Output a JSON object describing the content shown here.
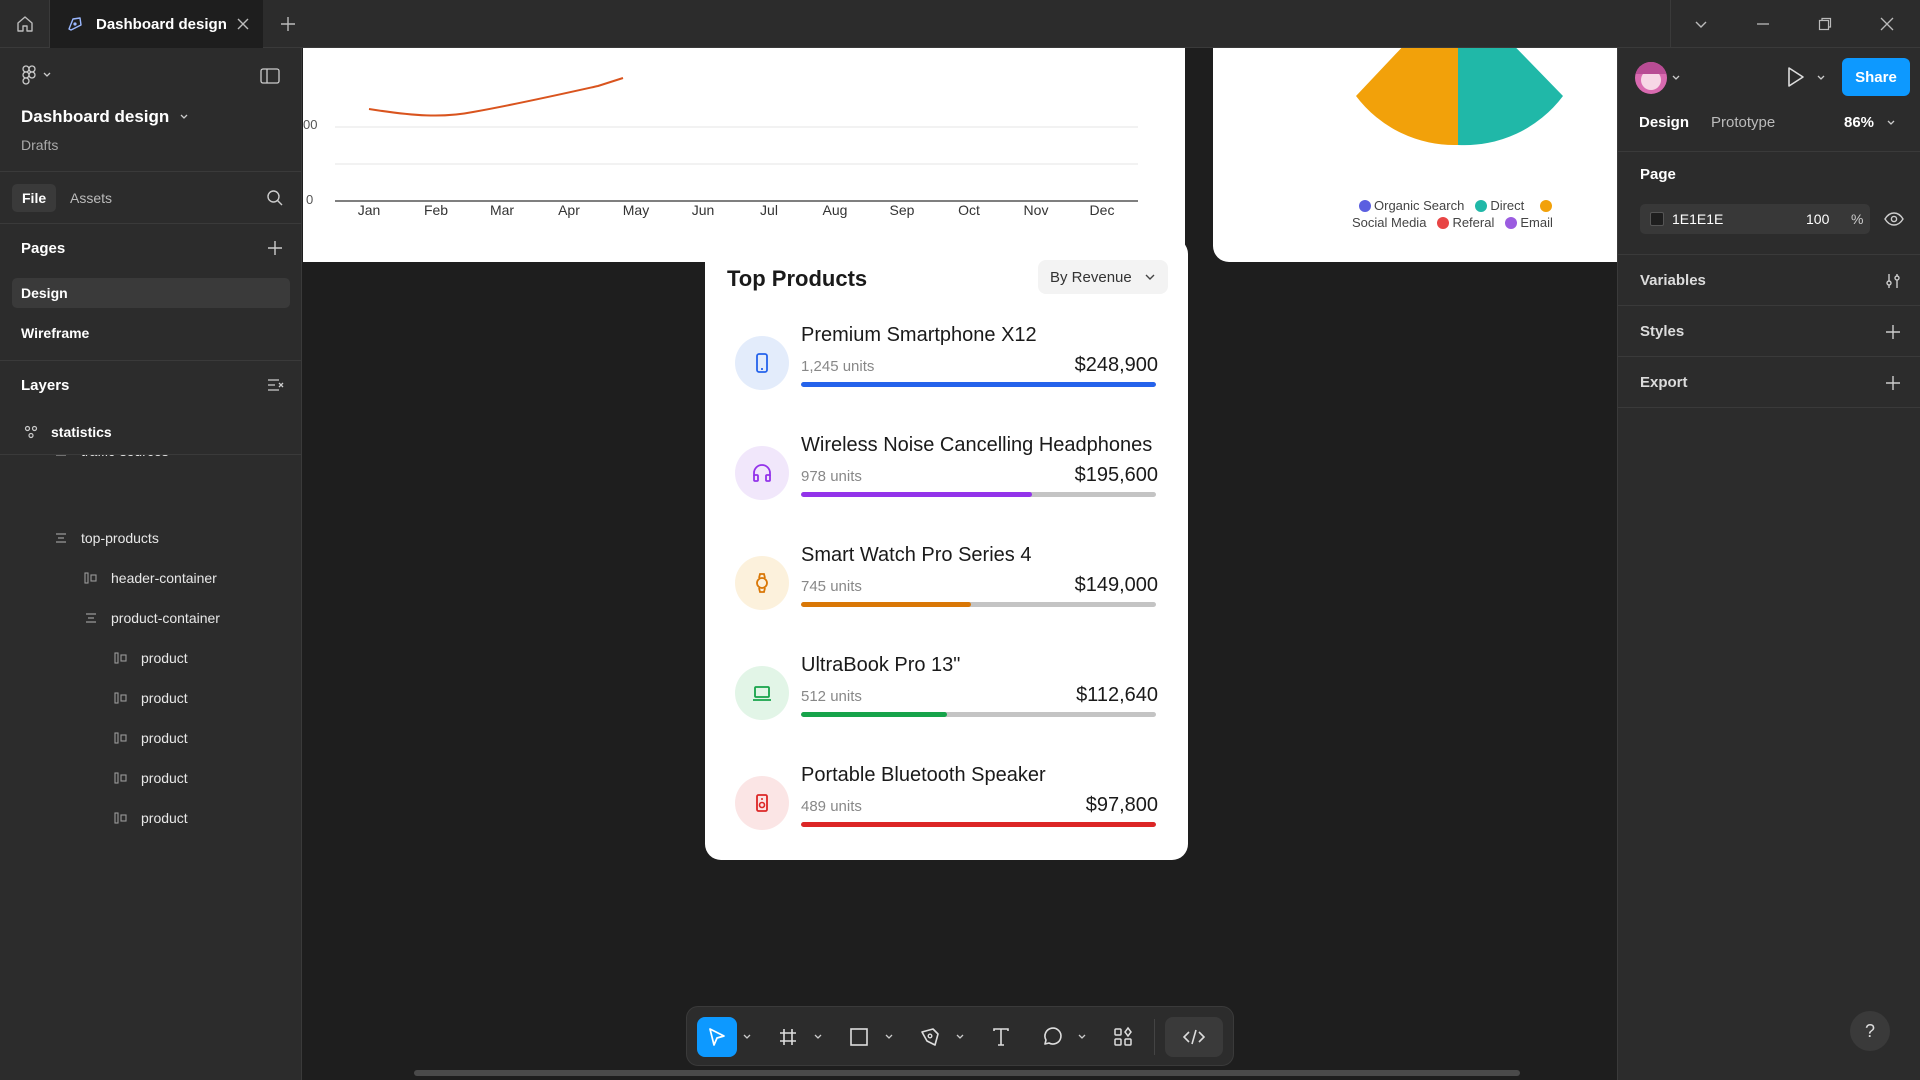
{
  "titlebar": {
    "tab_title": "Dashboard design"
  },
  "left_panel": {
    "file_name": "Dashboard design",
    "location": "Drafts",
    "tabs": [
      "File",
      "Assets"
    ],
    "pages_header": "Pages",
    "pages": [
      "Design",
      "Wireframe"
    ],
    "layers_header": "Layers",
    "layers": [
      {
        "name": "statistics"
      },
      {
        "name": "traffic-sources"
      },
      {
        "name": "top-products"
      },
      {
        "name": "header-container"
      },
      {
        "name": "product-container"
      },
      {
        "name": "product"
      },
      {
        "name": "product"
      },
      {
        "name": "product"
      },
      {
        "name": "product"
      },
      {
        "name": "product"
      }
    ]
  },
  "line_chart": {
    "axis_labels": [
      "00",
      "0"
    ],
    "months": [
      "Jan",
      "Feb",
      "Mar",
      "Apr",
      "May",
      "Jun",
      "Jul",
      "Aug",
      "Sep",
      "Oct",
      "Nov",
      "Dec"
    ]
  },
  "pie_chart": {
    "legend": [
      {
        "label": "Organic Search",
        "color": "#5b5fe0"
      },
      {
        "label": "Direct",
        "color": "#20b8a8"
      },
      {
        "label": "Social Media",
        "color": "#f2a10a"
      },
      {
        "label": "Referal",
        "color": "#e84545"
      },
      {
        "label": "Email",
        "color": "#9b5ce0"
      }
    ]
  },
  "top_products": {
    "title": "Top Products",
    "sort_label": "By Revenue",
    "products": [
      {
        "name": "Premium Smartphone X12",
        "units": "1,245 units",
        "revenue": "$248,900",
        "share": 1.0,
        "color": "#2563eb",
        "bg": "#e3ecfb",
        "icon": "smartphone-icon"
      },
      {
        "name": "Wireless Noise Cancelling Headphones",
        "units": "978 units",
        "revenue": "$195,600",
        "share": 0.65,
        "color": "#9333ea",
        "bg": "#f1e7fb",
        "icon": "headphones-icon"
      },
      {
        "name": "Smart Watch Pro Series 4",
        "units": "745 units",
        "revenue": "$149,000",
        "share": 0.48,
        "color": "#d97706",
        "bg": "#fcf1dc",
        "icon": "watch-icon"
      },
      {
        "name": "UltraBook Pro 13\"",
        "units": "512 units",
        "revenue": "$112,640",
        "share": 0.41,
        "color": "#16a34a",
        "bg": "#e2f5e7",
        "icon": "laptop-icon"
      },
      {
        "name": "Portable Bluetooth Speaker",
        "units": "489 units",
        "revenue": "$97,800",
        "share": 1.0,
        "color": "#dc2626",
        "bg": "#fbe5e5",
        "icon": "speaker-icon"
      }
    ]
  },
  "right_panel": {
    "tabs": [
      "Design",
      "Prototype"
    ],
    "zoom": "86%",
    "share_label": "Share",
    "page_header": "Page",
    "page_color": "1E1E1E",
    "page_opacity": "100",
    "percent_sign": "%",
    "sections": [
      "Variables",
      "Styles",
      "Export"
    ]
  },
  "help_label": "?"
}
